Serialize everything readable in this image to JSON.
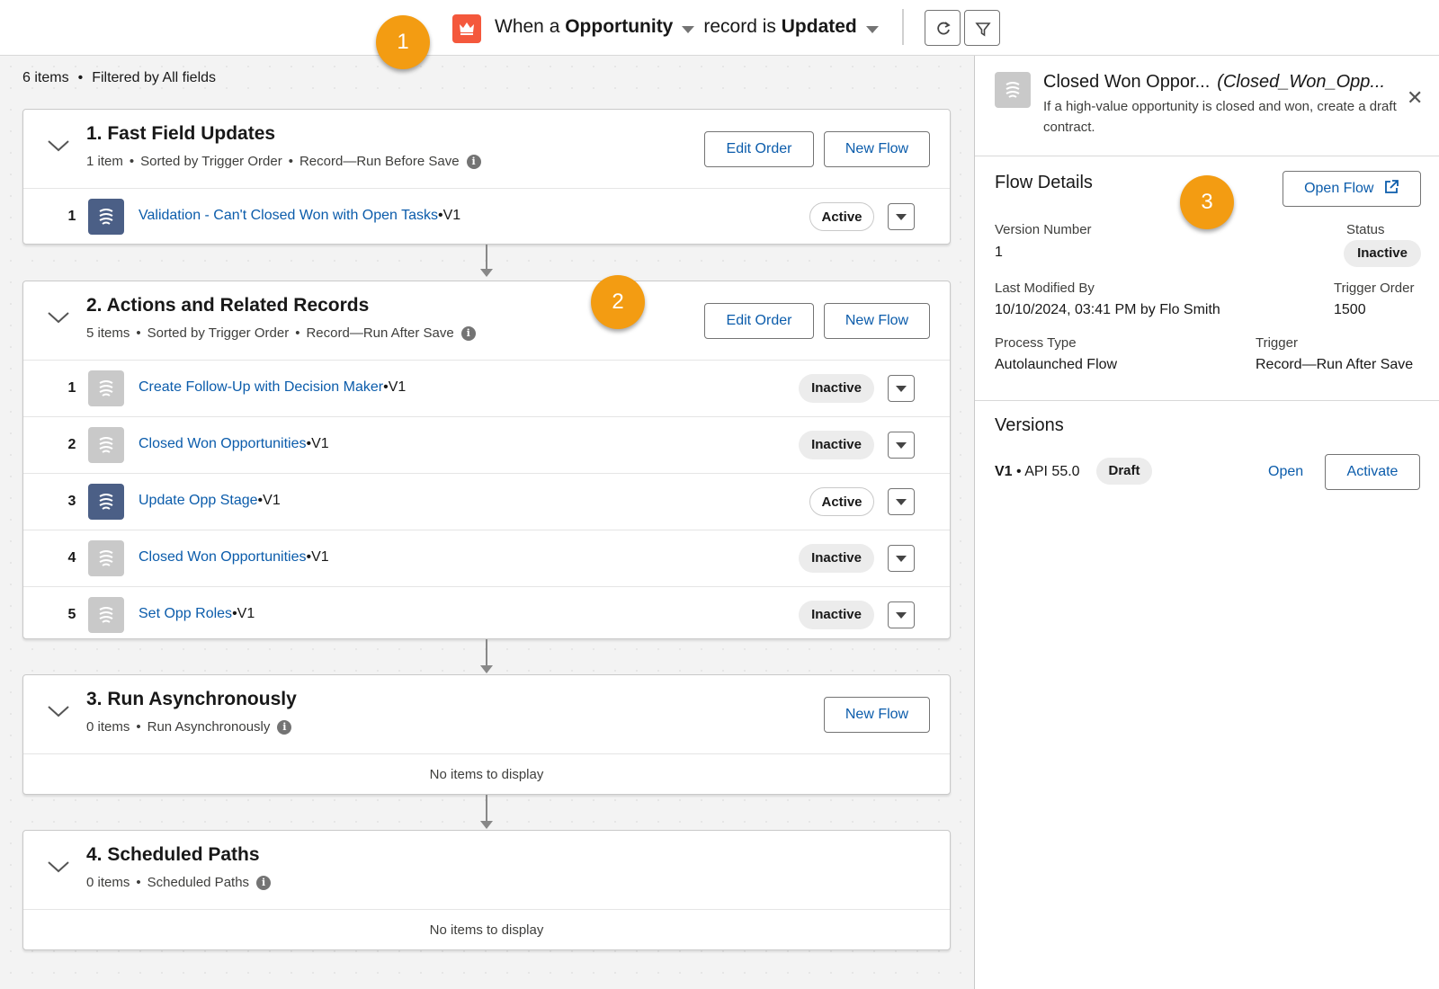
{
  "header": {
    "trigger_prefix": "When a",
    "object": "Opportunity",
    "middle": "record is",
    "event": "Updated"
  },
  "summary": {
    "count": "6 items",
    "filter": "Filtered by All fields"
  },
  "sections": [
    {
      "title": "1. Fast Field Updates",
      "count": "1 item",
      "sort": "Sorted by Trigger Order",
      "run": "Record—Run Before Save",
      "edit_order": "Edit Order",
      "new_flow": "New Flow",
      "rows": [
        {
          "num": "1",
          "name": "Validation - Can't Closed Won with Open Tasks",
          "version": "•V1",
          "status": "Active"
        }
      ]
    },
    {
      "title": "2. Actions and Related Records",
      "count": "5 items",
      "sort": "Sorted by Trigger Order",
      "run": "Record—Run After Save",
      "edit_order": "Edit Order",
      "new_flow": "New Flow",
      "rows": [
        {
          "num": "1",
          "name": "Create Follow-Up with Decision Maker",
          "version": "•V1",
          "status": "Inactive"
        },
        {
          "num": "2",
          "name": "Closed Won Opportunities",
          "version": "•V1",
          "status": "Inactive"
        },
        {
          "num": "3",
          "name": "Update Opp Stage",
          "version": "•V1",
          "status": "Active"
        },
        {
          "num": "4",
          "name": "Closed Won Opportunities",
          "version": "•V1",
          "status": "Inactive"
        },
        {
          "num": "5",
          "name": "Set Opp Roles",
          "version": "•V1",
          "status": "Inactive"
        }
      ]
    },
    {
      "title": "3. Run Asynchronously",
      "count": "0 items",
      "run": "Run Asynchronously",
      "new_flow": "New Flow",
      "empty": "No items to display"
    },
    {
      "title": "4. Scheduled Paths",
      "count": "0 items",
      "run": "Scheduled Paths",
      "empty": "No items to display"
    }
  ],
  "panel": {
    "title": "Closed Won Oppor...",
    "api_name": "(Closed_Won_Opp...",
    "description": "If a high-value opportunity is closed and won, create a draft contract.",
    "flow_details_title": "Flow Details",
    "open_flow": "Open Flow",
    "version_number_label": "Version Number",
    "version_number": "1",
    "status_label": "Status",
    "status": "Inactive",
    "last_modified_label": "Last Modified By",
    "last_modified": "10/10/2024, 03:41 PM by Flo Smith",
    "trigger_order_label": "Trigger Order",
    "trigger_order": "1500",
    "process_type_label": "Process Type",
    "process_type": "Autolaunched Flow",
    "trigger_label": "Trigger",
    "trigger": "Record—Run After Save",
    "versions_title": "Versions",
    "version_label": "V1",
    "version_api": "API 55.0",
    "version_status": "Draft",
    "open": "Open",
    "activate": "Activate"
  },
  "callouts": [
    "1",
    "2",
    "3"
  ],
  "colors": {
    "brand_link": "#0b5cab",
    "trigger_icon": "#f4583c",
    "active_flow_icon": "#4b5f86",
    "inactive_flow_icon": "#c9c9c9",
    "callout": "#f39c12"
  }
}
